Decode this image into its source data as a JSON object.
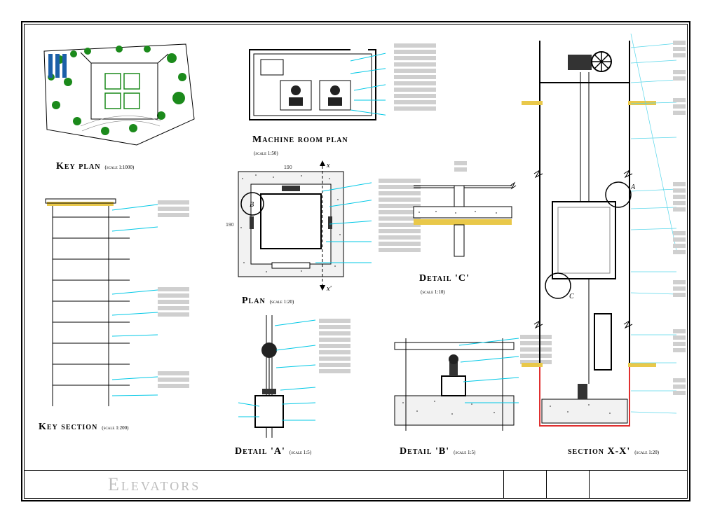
{
  "sheet": {
    "title": "Elevators"
  },
  "views": {
    "keyplan": {
      "title": "Key plan",
      "scale": "(scale 1:1000)"
    },
    "machine": {
      "title": "Machine room plan",
      "scale": "(scale 1:50)"
    },
    "plan": {
      "title": "Plan",
      "scale": "(scale 1:20)"
    },
    "keysection": {
      "title": "Key section",
      "scale": "(scale 1:200)"
    },
    "detailA": {
      "title": "Detail 'A'",
      "scale": "(scale 1:5)"
    },
    "detailB": {
      "title": "Detail 'B'",
      "scale": "(scale 1:5)"
    },
    "detailC": {
      "title": "Detail 'C'",
      "scale": "(scale 1:10)"
    },
    "sectionXX": {
      "title": "section X-X'",
      "scale": "(scale 1:20)"
    }
  },
  "dims": {
    "plan_w": "190",
    "plan_h": "190"
  },
  "marks": {
    "A": "A",
    "B": "B",
    "C": "C",
    "X": "x",
    "Xp": "x'"
  }
}
